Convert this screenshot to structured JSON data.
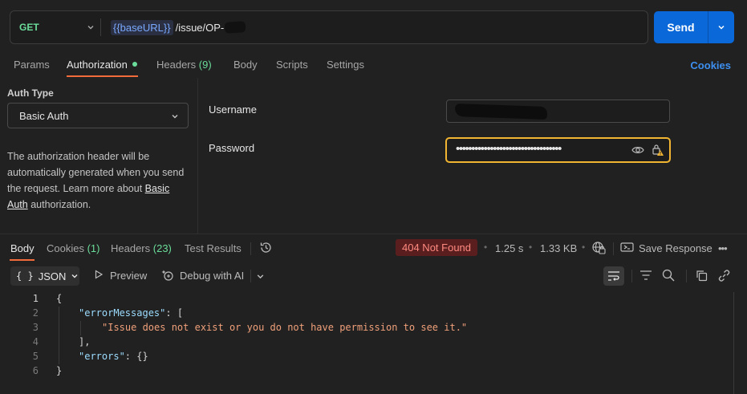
{
  "request": {
    "method": "GET",
    "url_var": "{{baseURL}}",
    "url_path": "/issue/OP-",
    "send_label": "Send"
  },
  "tabs": [
    {
      "label": "Params"
    },
    {
      "label": "Authorization"
    },
    {
      "label": "Headers",
      "count": "(9)"
    },
    {
      "label": "Body"
    },
    {
      "label": "Scripts"
    },
    {
      "label": "Settings"
    }
  ],
  "cookies_link": "Cookies",
  "auth": {
    "type_label": "Auth Type",
    "type_value": "Basic Auth",
    "desc_1": "The authorization header will be automatically generated when you send the request. Learn more about ",
    "desc_link": "Basic Auth",
    "desc_2": " authorization.",
    "username_label": "Username",
    "password_label": "Password",
    "password_mask": "••••••••••••••••••••••••••••••••••"
  },
  "response": {
    "tabs": [
      {
        "label": "Body"
      },
      {
        "label": "Cookies",
        "count": "(1)"
      },
      {
        "label": "Headers",
        "count": "(23)"
      },
      {
        "label": "Test Results"
      }
    ],
    "status": "404 Not Found",
    "time": "1.25 s",
    "size": "1.33 KB",
    "save_label": "Save Response",
    "more": "•••"
  },
  "format": {
    "braces": "{ }",
    "type": "JSON",
    "preview": "Preview",
    "debug": "Debug with AI"
  },
  "code": {
    "line_numbers": [
      "1",
      "2",
      "3",
      "4",
      "5",
      "6"
    ],
    "l1": "{",
    "l2_key": "\"errorMessages\"",
    "l2_rest": ": [",
    "l3": "\"Issue does not exist or you do not have permission to see it.\"",
    "l4": "],",
    "l5_key": "\"errors\"",
    "l5_rest": ": {}",
    "l6": "}"
  }
}
